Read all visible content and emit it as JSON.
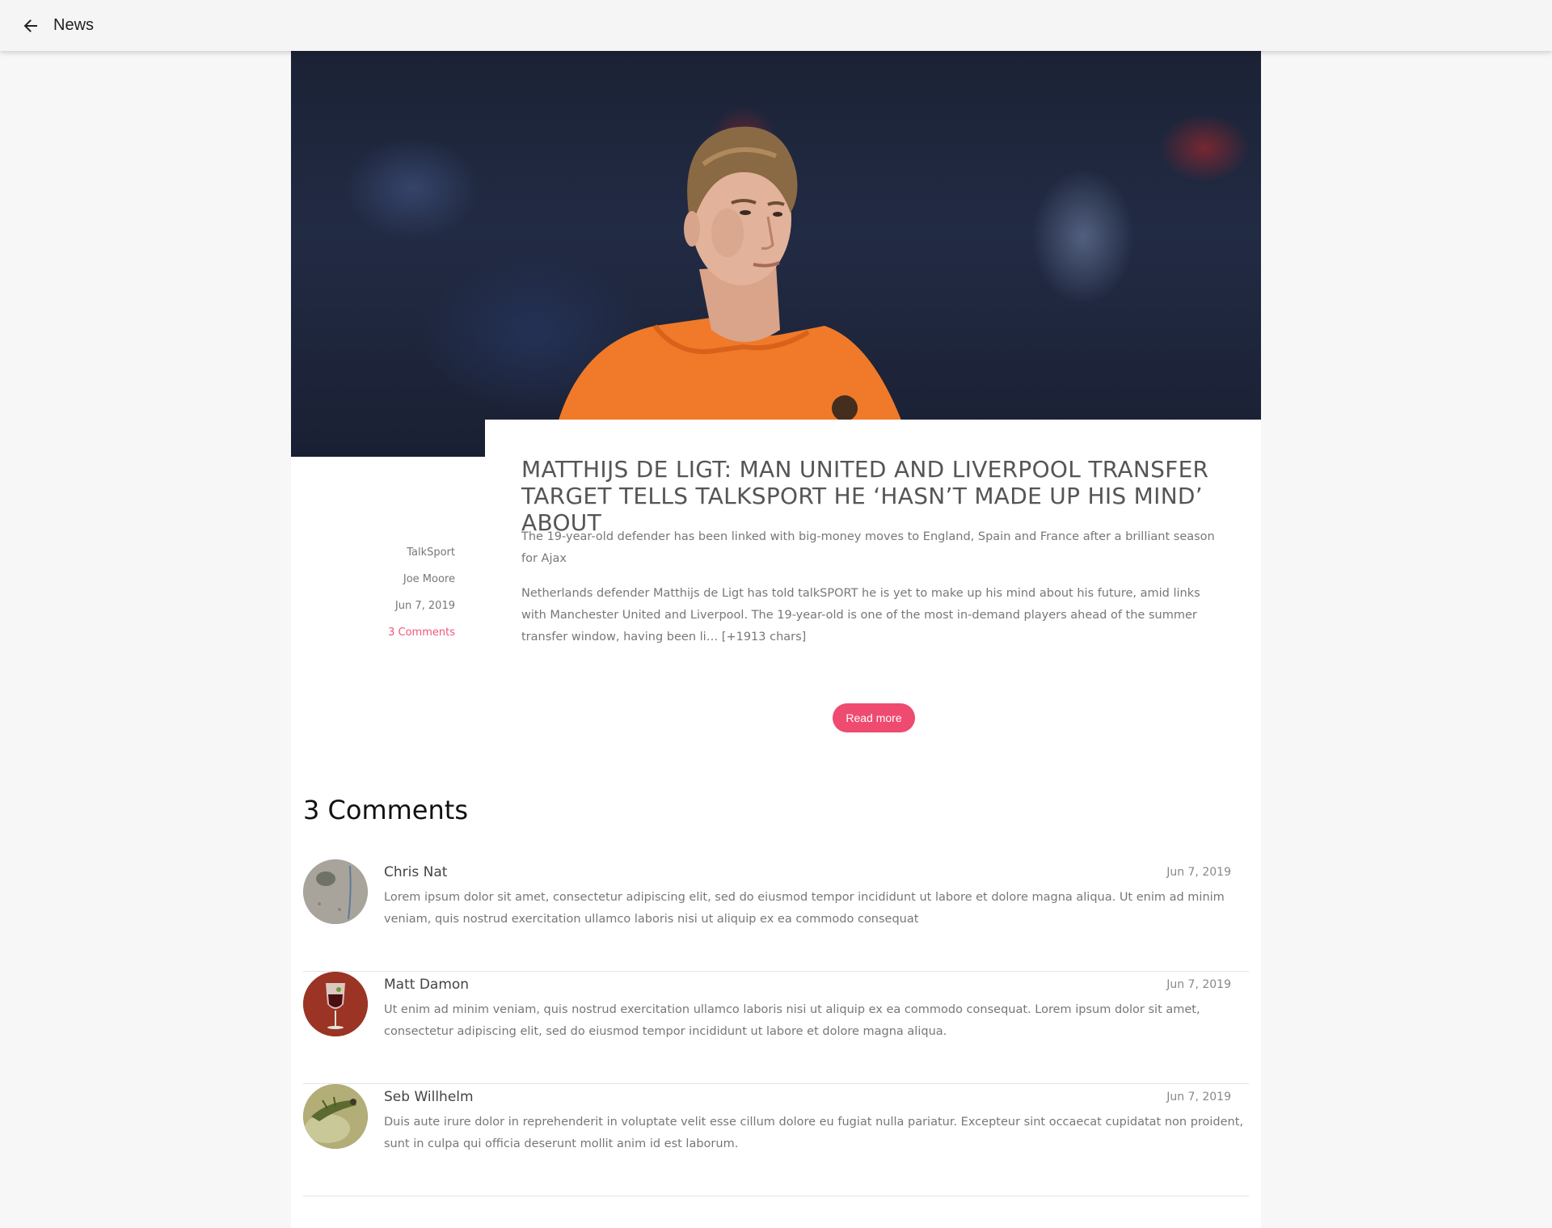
{
  "topbar": {
    "back_icon": "arrow-left-icon",
    "title": "News"
  },
  "article": {
    "meta": {
      "source": "TalkSport",
      "author": "Joe Moore",
      "date": "Jun 7, 2019",
      "comments_link": "3 Comments"
    },
    "title": "MATTHIJS DE LIGT: MAN UNITED AND LIVERPOOL TRANSFER TARGET TELLS TALKSPORT HE ‘HASN’T MADE UP HIS MIND’ ABOUT",
    "summary": "The 19-year-old defender has been linked with big-money moves to England, Spain and France after a brilliant season for Ajax",
    "body": "Netherlands defender Matthijs de Ligt has told talkSPORT he is yet to make up his mind about his future, amid links with Manchester United and Liverpool. The 19-year-old is one of the most in-demand players ahead of the summer transfer window, having been li… [+1913 chars]",
    "read_more_label": "Read more"
  },
  "comments": {
    "heading": "3 Comments",
    "items": [
      {
        "name": "Chris Nat",
        "date": "Jun 7, 2019",
        "text": "Lorem ipsum dolor sit amet, consectetur adipiscing elit, sed do eiusmod tempor incididunt ut labore et dolore magna aliqua. Ut enim ad minim veniam, quis nostrud exercitation ullamco laboris nisi ut aliquip ex ea commodo consequat"
      },
      {
        "name": "Matt Damon",
        "date": "Jun 7, 2019",
        "text": "Ut enim ad minim veniam, quis nostrud exercitation ullamco laboris nisi ut aliquip ex ea commodo consequat. Lorem ipsum dolor sit amet, consectetur adipiscing elit, sed do eiusmod tempor incididunt ut labore et dolore magna aliqua."
      },
      {
        "name": "Seb Willhelm",
        "date": "Jun 7, 2019",
        "text": "Duis aute irure dolor in reprehenderit in voluptate velit esse cillum dolore eu fugiat nulla pariatur. Excepteur sint occaecat cupidatat non proident, sunt in culpa qui officia deserunt mollit anim id est laborum."
      }
    ]
  },
  "colors": {
    "accent": "#ef4a6f",
    "comments_link": "#f0557a",
    "jersey": "#f07a2a"
  }
}
